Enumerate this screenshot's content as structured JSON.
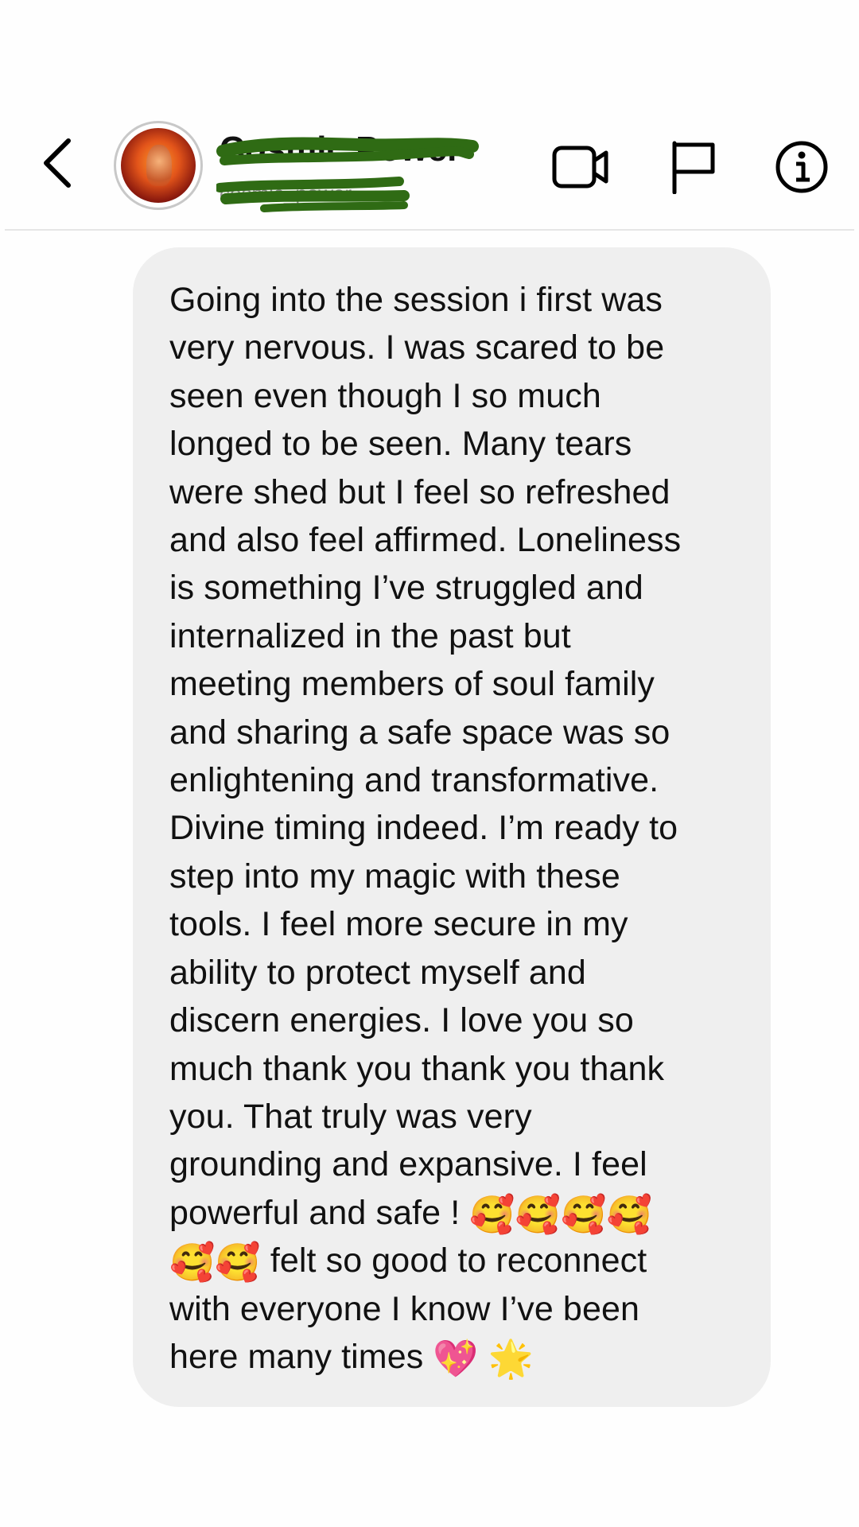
{
  "header": {
    "back_icon": "chevron-left-icon",
    "contact_name": "Cosmic Power",
    "contact_sub": "cosmic_power",
    "video_icon": "video-camera-icon",
    "flag_icon": "flag-icon",
    "info_icon": "info-icon",
    "redaction_color": "#2f6b14"
  },
  "message": {
    "bubble_color": "#efefef",
    "lines": [
      "Going into the session i first was",
      "very nervous. I was scared to be",
      "seen even though I so much",
      "longed to be seen. Many tears",
      "were shed but I feel so refreshed",
      "and also feel affirmed. Loneliness",
      "is something I’ve struggled and",
      "internalized in the past but",
      "meeting members of soul family",
      "and sharing a safe space was so",
      "enlightening and transformative.",
      "Divine timing indeed. I’m ready to",
      "step into my magic with these",
      "tools. I feel more secure in my",
      "ability to protect myself and",
      "discern energies. I love you so",
      "much thank you thank you thank",
      "you. That truly was very",
      "grounding and expansive. I feel"
    ],
    "line_powerful_text": "powerful and safe !",
    "line_felt_text": "felt so good to reconnect",
    "line_with_text": "with everyone I know I’ve been",
    "line_here_text": "here many times",
    "emoji_face": "🥰",
    "emoji_heart": "💖",
    "emoji_star": "🌟"
  }
}
